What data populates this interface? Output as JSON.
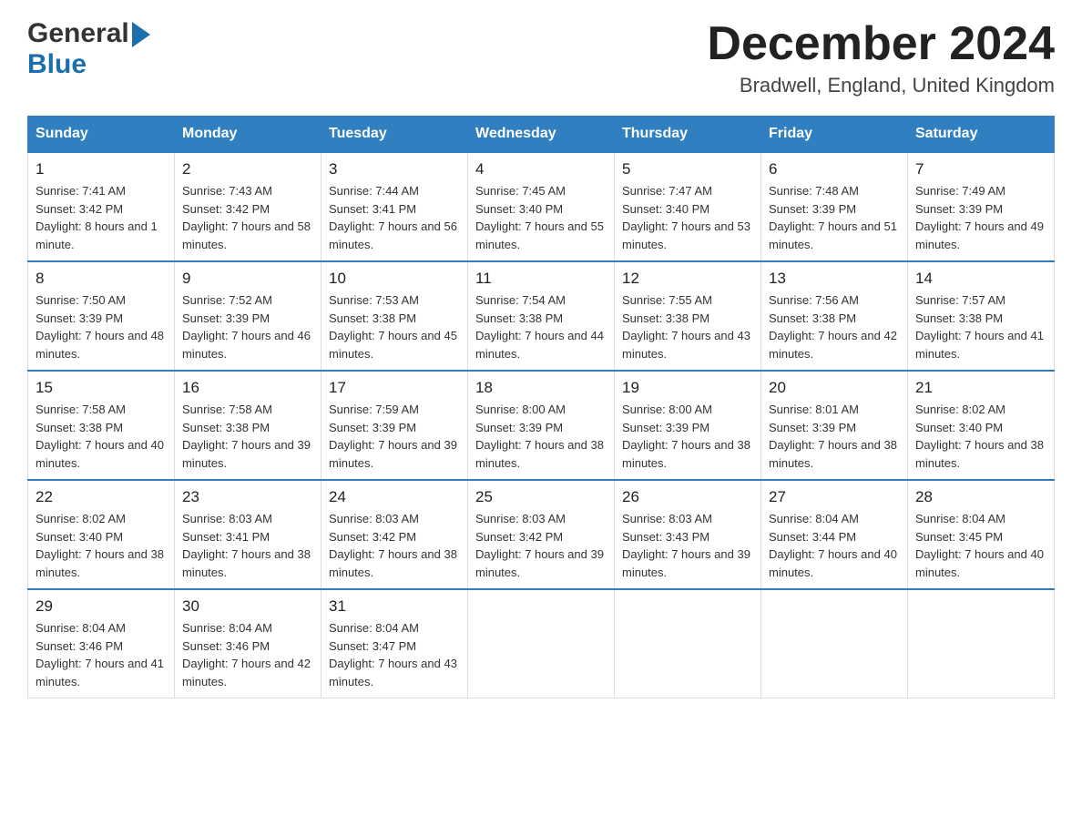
{
  "header": {
    "logo_general": "General",
    "logo_blue": "Blue",
    "title": "December 2024",
    "subtitle": "Bradwell, England, United Kingdom"
  },
  "days_of_week": [
    "Sunday",
    "Monday",
    "Tuesday",
    "Wednesday",
    "Thursday",
    "Friday",
    "Saturday"
  ],
  "weeks": [
    [
      {
        "day": "1",
        "sunrise": "7:41 AM",
        "sunset": "3:42 PM",
        "daylight": "8 hours and 1 minute."
      },
      {
        "day": "2",
        "sunrise": "7:43 AM",
        "sunset": "3:42 PM",
        "daylight": "7 hours and 58 minutes."
      },
      {
        "day": "3",
        "sunrise": "7:44 AM",
        "sunset": "3:41 PM",
        "daylight": "7 hours and 56 minutes."
      },
      {
        "day": "4",
        "sunrise": "7:45 AM",
        "sunset": "3:40 PM",
        "daylight": "7 hours and 55 minutes."
      },
      {
        "day": "5",
        "sunrise": "7:47 AM",
        "sunset": "3:40 PM",
        "daylight": "7 hours and 53 minutes."
      },
      {
        "day": "6",
        "sunrise": "7:48 AM",
        "sunset": "3:39 PM",
        "daylight": "7 hours and 51 minutes."
      },
      {
        "day": "7",
        "sunrise": "7:49 AM",
        "sunset": "3:39 PM",
        "daylight": "7 hours and 49 minutes."
      }
    ],
    [
      {
        "day": "8",
        "sunrise": "7:50 AM",
        "sunset": "3:39 PM",
        "daylight": "7 hours and 48 minutes."
      },
      {
        "day": "9",
        "sunrise": "7:52 AM",
        "sunset": "3:39 PM",
        "daylight": "7 hours and 46 minutes."
      },
      {
        "day": "10",
        "sunrise": "7:53 AM",
        "sunset": "3:38 PM",
        "daylight": "7 hours and 45 minutes."
      },
      {
        "day": "11",
        "sunrise": "7:54 AM",
        "sunset": "3:38 PM",
        "daylight": "7 hours and 44 minutes."
      },
      {
        "day": "12",
        "sunrise": "7:55 AM",
        "sunset": "3:38 PM",
        "daylight": "7 hours and 43 minutes."
      },
      {
        "day": "13",
        "sunrise": "7:56 AM",
        "sunset": "3:38 PM",
        "daylight": "7 hours and 42 minutes."
      },
      {
        "day": "14",
        "sunrise": "7:57 AM",
        "sunset": "3:38 PM",
        "daylight": "7 hours and 41 minutes."
      }
    ],
    [
      {
        "day": "15",
        "sunrise": "7:58 AM",
        "sunset": "3:38 PM",
        "daylight": "7 hours and 40 minutes."
      },
      {
        "day": "16",
        "sunrise": "7:58 AM",
        "sunset": "3:38 PM",
        "daylight": "7 hours and 39 minutes."
      },
      {
        "day": "17",
        "sunrise": "7:59 AM",
        "sunset": "3:39 PM",
        "daylight": "7 hours and 39 minutes."
      },
      {
        "day": "18",
        "sunrise": "8:00 AM",
        "sunset": "3:39 PM",
        "daylight": "7 hours and 38 minutes."
      },
      {
        "day": "19",
        "sunrise": "8:00 AM",
        "sunset": "3:39 PM",
        "daylight": "7 hours and 38 minutes."
      },
      {
        "day": "20",
        "sunrise": "8:01 AM",
        "sunset": "3:39 PM",
        "daylight": "7 hours and 38 minutes."
      },
      {
        "day": "21",
        "sunrise": "8:02 AM",
        "sunset": "3:40 PM",
        "daylight": "7 hours and 38 minutes."
      }
    ],
    [
      {
        "day": "22",
        "sunrise": "8:02 AM",
        "sunset": "3:40 PM",
        "daylight": "7 hours and 38 minutes."
      },
      {
        "day": "23",
        "sunrise": "8:03 AM",
        "sunset": "3:41 PM",
        "daylight": "7 hours and 38 minutes."
      },
      {
        "day": "24",
        "sunrise": "8:03 AM",
        "sunset": "3:42 PM",
        "daylight": "7 hours and 38 minutes."
      },
      {
        "day": "25",
        "sunrise": "8:03 AM",
        "sunset": "3:42 PM",
        "daylight": "7 hours and 39 minutes."
      },
      {
        "day": "26",
        "sunrise": "8:03 AM",
        "sunset": "3:43 PM",
        "daylight": "7 hours and 39 minutes."
      },
      {
        "day": "27",
        "sunrise": "8:04 AM",
        "sunset": "3:44 PM",
        "daylight": "7 hours and 40 minutes."
      },
      {
        "day": "28",
        "sunrise": "8:04 AM",
        "sunset": "3:45 PM",
        "daylight": "7 hours and 40 minutes."
      }
    ],
    [
      {
        "day": "29",
        "sunrise": "8:04 AM",
        "sunset": "3:46 PM",
        "daylight": "7 hours and 41 minutes."
      },
      {
        "day": "30",
        "sunrise": "8:04 AM",
        "sunset": "3:46 PM",
        "daylight": "7 hours and 42 minutes."
      },
      {
        "day": "31",
        "sunrise": "8:04 AM",
        "sunset": "3:47 PM",
        "daylight": "7 hours and 43 minutes."
      },
      null,
      null,
      null,
      null
    ]
  ]
}
